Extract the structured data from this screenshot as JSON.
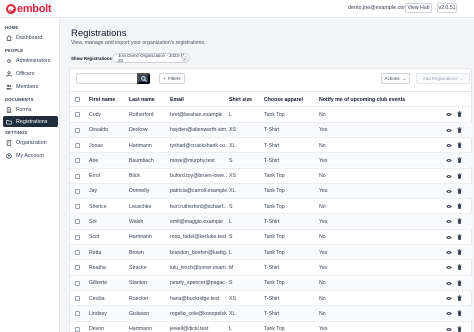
{
  "header": {
    "logo_text": "embolt",
    "user_email": "demo.joe@example.com",
    "view_hub_label": "View Hub",
    "version_label": "v2.0.51"
  },
  "sidebar": {
    "sections": {
      "home": "HOME",
      "people": "PEOPLE",
      "documents": "DOCUMENTS",
      "settings": "SETTINGS"
    },
    "items": [
      {
        "label": "Dashboard",
        "icon": "home-icon"
      },
      {
        "label": "Administrators",
        "icon": "gear-icon"
      },
      {
        "label": "Officers",
        "icon": "user-icon"
      },
      {
        "label": "Members",
        "icon": "users-icon"
      },
      {
        "label": "Forms",
        "icon": "document-icon"
      },
      {
        "label": "Registrations",
        "icon": "folder-icon"
      },
      {
        "label": "Organization",
        "icon": "building-icon"
      },
      {
        "label": "My Account",
        "icon": "account-icon"
      }
    ],
    "active_index": 5
  },
  "main": {
    "title": "Registrations",
    "subtitle": "View, manage and export your organization's registrations.",
    "show_label": "Show Registrations for:",
    "org_selected": "Join Demo Organization - 2023-11-20",
    "toolbar": {
      "search_placeholder": "",
      "filters_label": "Filters",
      "actions_label": "Actions",
      "add_label": "Add Registrations"
    },
    "table": {
      "columns": [
        "First name",
        "Last name",
        "Email",
        "Shirt size",
        "Choose apparel",
        "Notify me of upcoming club events"
      ],
      "rows": [
        {
          "first": "Cody",
          "last": "Rutherford",
          "email": "bret@beahan.example",
          "size": "L",
          "apparel": "Tank Top",
          "notify": "No"
        },
        {
          "first": "Osvaldo",
          "last": "Deckow",
          "email": "hayden@altenwerth-sim…",
          "size": "XS",
          "apparel": "T-Shirt",
          "notify": "Yes"
        },
        {
          "first": "Jonas",
          "last": "Hartmann",
          "email": "tyshad@cruickshank-cu…",
          "size": "XL",
          "apparel": "T-Shirt",
          "notify": "No"
        },
        {
          "first": "Arie",
          "last": "Baumbach",
          "email": "mose@murphy.test",
          "size": "S",
          "apparel": "T-Shirt",
          "notify": "Yes"
        },
        {
          "first": "Errol",
          "last": "Blick",
          "email": "buford.toy@bruen-lowe…",
          "size": "XS",
          "apparel": "Tank Top",
          "notify": "No"
        },
        {
          "first": "Jay",
          "last": "Donnelly",
          "email": "patricia@carroll.example",
          "size": "XL",
          "apparel": "Tank Top",
          "notify": "Yes"
        },
        {
          "first": "Sherice",
          "last": "Leuschke",
          "email": "burl.rutherford@schaef…",
          "size": "S",
          "apparel": "Tank Top",
          "notify": "No"
        },
        {
          "first": "Sol",
          "last": "Walsh",
          "email": "emil@maggio.example",
          "size": "L",
          "apparel": "T-Shirt",
          "notify": "Yes"
        },
        {
          "first": "Scot",
          "last": "Hartmann",
          "email": "rosa_fadel@kerluke.test",
          "size": "S",
          "apparel": "Tank Top",
          "notify": "No"
        },
        {
          "first": "Retta",
          "last": "Brown",
          "email": "brandon_boehm@luettg…",
          "size": "L",
          "apparel": "Tank Top",
          "notify": "Yes"
        },
        {
          "first": "Reatha",
          "last": "Stracke",
          "email": "lulu_lesch@turner.exam…",
          "size": "M",
          "apparel": "T-Shirt",
          "notify": "Yes"
        },
        {
          "first": "Gilberte",
          "last": "Stanton",
          "email": "pearly_spencer@pagac-j…",
          "size": "S",
          "apparel": "Tank Top",
          "notify": "No"
        },
        {
          "first": "Cecilia",
          "last": "Ruecker",
          "email": "hana@buckridge.test",
          "size": "XS",
          "apparel": "T-Shirt",
          "notify": "No"
        },
        {
          "first": "Lindsey",
          "last": "Gislason",
          "email": "rogelio_cole@konopelsk…",
          "size": "XL",
          "apparel": "T-Shirt",
          "notify": "No"
        },
        {
          "first": "Devon",
          "last": "Hartmann",
          "email": "jewell@dicki.test",
          "size": "L",
          "apparel": "Tank Top",
          "notify": "Yes"
        }
      ]
    }
  },
  "colors": {
    "brand": "#e0263f",
    "active_nav": "#1f2d3d",
    "search_button": "#334155"
  }
}
